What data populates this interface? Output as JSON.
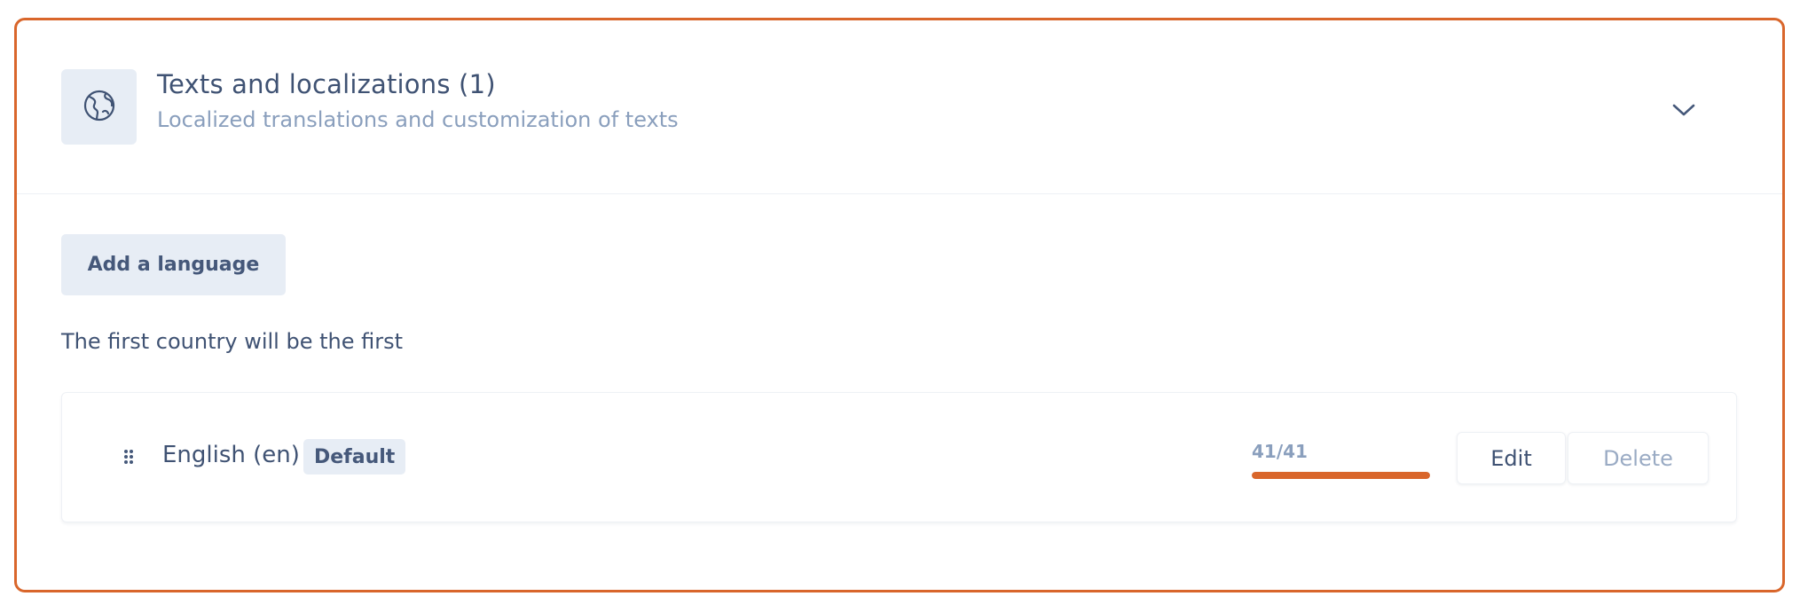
{
  "section": {
    "title": "Texts and localizations (1)",
    "subtitle": "Localized translations and customization of texts",
    "icon": "globe-icon",
    "toggle_icon": "chevron-down-icon"
  },
  "actions": {
    "add_language_label": "Add a language"
  },
  "note": "The first country will be the first",
  "languages": [
    {
      "name": "English (en)",
      "badge": "Default",
      "progress_label": "41/41",
      "progress_fraction": 1.0,
      "edit_label": "Edit",
      "delete_label": "Delete",
      "drag_icon": "drag-handle-icon"
    }
  ],
  "colors": {
    "accent": "#d9662b",
    "text_primary": "#3f5273",
    "text_muted": "#8a9fbd",
    "tile_bg": "#e7edf5"
  }
}
